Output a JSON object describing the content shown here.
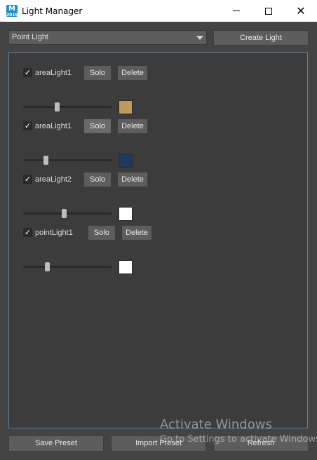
{
  "window": {
    "title": "Light Manager",
    "app_icon_letter": "M",
    "app_icon_sub": "2019"
  },
  "toolbar": {
    "light_type_selected": "Point Light",
    "create_label": "Create Light"
  },
  "lights": [
    {
      "name": "areaLight1",
      "checked": true,
      "solo_label": "Solo",
      "delete_label": "Delete",
      "intensity": 0.38,
      "color": "#c09a5a",
      "solo_active": false
    },
    {
      "name": "areaLight1",
      "checked": true,
      "solo_label": "Solo",
      "delete_label": "Delete",
      "intensity": 0.25,
      "color": "#1e3a5f",
      "solo_active": true
    },
    {
      "name": "areaLight2",
      "checked": true,
      "solo_label": "Solo",
      "delete_label": "Delete",
      "intensity": 0.46,
      "color": "#ffffff",
      "solo_active": false
    },
    {
      "name": "pointLight1",
      "checked": true,
      "solo_label": "Solo",
      "delete_label": "Delete",
      "intensity": 0.27,
      "color": "#ffffff",
      "solo_active": false
    }
  ],
  "footer": {
    "save_label": "Save Preset",
    "import_label": "Import Preset",
    "refresh_label": "Refresh"
  },
  "watermark": {
    "line1": "Activate Windows",
    "line2": "Go to Settings to activate Windows."
  },
  "colors": {
    "panel_border": "#5285a6",
    "button": "#5d5d5d"
  }
}
